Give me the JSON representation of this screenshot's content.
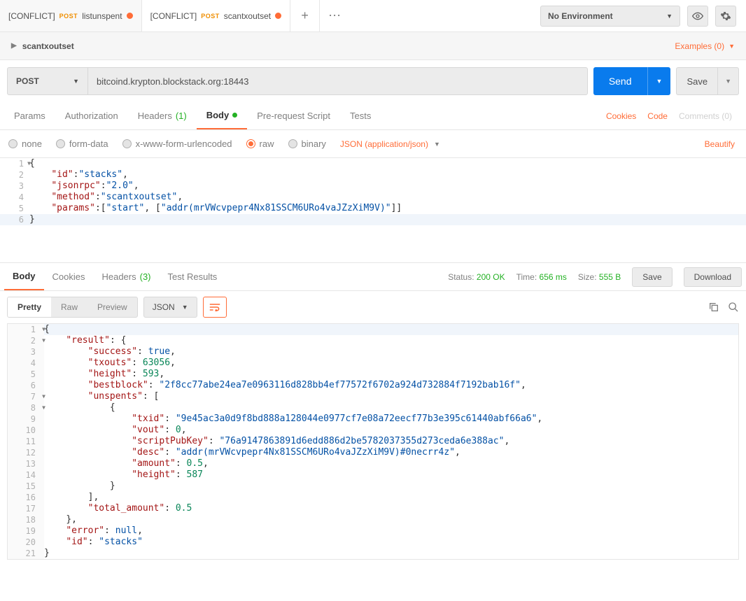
{
  "env": {
    "label": "No Environment"
  },
  "tabs": [
    {
      "conflict": "[CONFLICT]",
      "method": "POST",
      "name": "listunspent"
    },
    {
      "conflict": "[CONFLICT]",
      "method": "POST",
      "name": "scantxoutset"
    }
  ],
  "request_name": "scantxoutset",
  "examples": "Examples (0)",
  "method": "POST",
  "url": "bitcoind.krypton.blockstack.org:18443",
  "send": "Send",
  "save": "Save",
  "req_tabs": {
    "params": "Params",
    "auth": "Authorization",
    "headers": "Headers",
    "headers_count": "(1)",
    "body": "Body",
    "prereq": "Pre-request Script",
    "tests": "Tests"
  },
  "req_right": {
    "cookies": "Cookies",
    "code": "Code",
    "comments": "Comments (0)"
  },
  "body_types": {
    "none": "none",
    "formdata": "form-data",
    "xwww": "x-www-form-urlencoded",
    "raw": "raw",
    "binary": "binary",
    "content_type": "JSON (application/json)",
    "beautify": "Beautify"
  },
  "request_body": [
    {
      "n": "1",
      "fold": true,
      "hl": false,
      "indent": 0,
      "tokens": [
        [
          "brace",
          "{"
        ]
      ]
    },
    {
      "n": "2",
      "fold": false,
      "hl": false,
      "indent": 1,
      "tokens": [
        [
          "key",
          "\"id\""
        ],
        [
          "punct",
          ":"
        ],
        [
          "str",
          "\"stacks\""
        ],
        [
          "punct",
          ","
        ]
      ]
    },
    {
      "n": "3",
      "fold": false,
      "hl": false,
      "indent": 1,
      "tokens": [
        [
          "key",
          "\"jsonrpc\""
        ],
        [
          "punct",
          ":"
        ],
        [
          "str",
          "\"2.0\""
        ],
        [
          "punct",
          ","
        ]
      ]
    },
    {
      "n": "4",
      "fold": false,
      "hl": false,
      "indent": 1,
      "tokens": [
        [
          "key",
          "\"method\""
        ],
        [
          "punct",
          ":"
        ],
        [
          "str",
          "\"scantxoutset\""
        ],
        [
          "punct",
          ","
        ]
      ]
    },
    {
      "n": "5",
      "fold": false,
      "hl": false,
      "indent": 1,
      "tokens": [
        [
          "key",
          "\"params\""
        ],
        [
          "punct",
          ":["
        ],
        [
          "str",
          "\"start\""
        ],
        [
          "punct",
          ", ["
        ],
        [
          "str",
          "\"addr(mrVWcvpepr4Nx81SSCM6URo4vaJZzXiM9V)\""
        ],
        [
          "punct",
          "]]"
        ]
      ]
    },
    {
      "n": "6",
      "fold": false,
      "hl": true,
      "indent": 0,
      "tokens": [
        [
          "brace",
          "}"
        ]
      ]
    }
  ],
  "resp_tabs": {
    "body": "Body",
    "cookies": "Cookies",
    "headers": "Headers",
    "headers_count": "(3)",
    "tests": "Test Results"
  },
  "resp_meta": {
    "status_label": "Status:",
    "status_value": "200 OK",
    "time_label": "Time:",
    "time_value": "656 ms",
    "size_label": "Size:",
    "size_value": "555 B",
    "save": "Save",
    "download": "Download"
  },
  "view_tabs": {
    "pretty": "Pretty",
    "raw": "Raw",
    "preview": "Preview",
    "format": "JSON"
  },
  "response_body": [
    {
      "n": "1",
      "fold": true,
      "hl": true,
      "indent": 0,
      "tokens": [
        [
          "brace",
          "{"
        ]
      ]
    },
    {
      "n": "2",
      "fold": true,
      "hl": false,
      "indent": 1,
      "tokens": [
        [
          "key",
          "\"result\""
        ],
        [
          "punct",
          ": "
        ],
        [
          "brace",
          "{"
        ]
      ]
    },
    {
      "n": "3",
      "fold": false,
      "hl": false,
      "indent": 2,
      "tokens": [
        [
          "key",
          "\"success\""
        ],
        [
          "punct",
          ": "
        ],
        [
          "bool",
          "true"
        ],
        [
          "punct",
          ","
        ]
      ]
    },
    {
      "n": "4",
      "fold": false,
      "hl": false,
      "indent": 2,
      "tokens": [
        [
          "key",
          "\"txouts\""
        ],
        [
          "punct",
          ": "
        ],
        [
          "num",
          "63056"
        ],
        [
          "punct",
          ","
        ]
      ]
    },
    {
      "n": "5",
      "fold": false,
      "hl": false,
      "indent": 2,
      "tokens": [
        [
          "key",
          "\"height\""
        ],
        [
          "punct",
          ": "
        ],
        [
          "num",
          "593"
        ],
        [
          "punct",
          ","
        ]
      ]
    },
    {
      "n": "6",
      "fold": false,
      "hl": false,
      "indent": 2,
      "tokens": [
        [
          "key",
          "\"bestblock\""
        ],
        [
          "punct",
          ": "
        ],
        [
          "str",
          "\"2f8cc77abe24ea7e0963116d828bb4ef77572f6702a924d732884f7192bab16f\""
        ],
        [
          "punct",
          ","
        ]
      ]
    },
    {
      "n": "7",
      "fold": true,
      "hl": false,
      "indent": 2,
      "tokens": [
        [
          "key",
          "\"unspents\""
        ],
        [
          "punct",
          ": ["
        ]
      ]
    },
    {
      "n": "8",
      "fold": true,
      "hl": false,
      "indent": 3,
      "tokens": [
        [
          "brace",
          "{"
        ]
      ]
    },
    {
      "n": "9",
      "fold": false,
      "hl": false,
      "indent": 4,
      "tokens": [
        [
          "key",
          "\"txid\""
        ],
        [
          "punct",
          ": "
        ],
        [
          "str",
          "\"9e45ac3a0d9f8bd888a128044e0977cf7e08a72eecf77b3e395c61440abf66a6\""
        ],
        [
          "punct",
          ","
        ]
      ]
    },
    {
      "n": "10",
      "fold": false,
      "hl": false,
      "indent": 4,
      "tokens": [
        [
          "key",
          "\"vout\""
        ],
        [
          "punct",
          ": "
        ],
        [
          "num",
          "0"
        ],
        [
          "punct",
          ","
        ]
      ]
    },
    {
      "n": "11",
      "fold": false,
      "hl": false,
      "indent": 4,
      "tokens": [
        [
          "key",
          "\"scriptPubKey\""
        ],
        [
          "punct",
          ": "
        ],
        [
          "str",
          "\"76a9147863891d6edd886d2be5782037355d273ceda6e388ac\""
        ],
        [
          "punct",
          ","
        ]
      ]
    },
    {
      "n": "12",
      "fold": false,
      "hl": false,
      "indent": 4,
      "tokens": [
        [
          "key",
          "\"desc\""
        ],
        [
          "punct",
          ": "
        ],
        [
          "str",
          "\"addr(mrVWcvpepr4Nx81SSCM6URo4vaJZzXiM9V)#0necrr4z\""
        ],
        [
          "punct",
          ","
        ]
      ]
    },
    {
      "n": "13",
      "fold": false,
      "hl": false,
      "indent": 4,
      "tokens": [
        [
          "key",
          "\"amount\""
        ],
        [
          "punct",
          ": "
        ],
        [
          "num",
          "0.5"
        ],
        [
          "punct",
          ","
        ]
      ]
    },
    {
      "n": "14",
      "fold": false,
      "hl": false,
      "indent": 4,
      "tokens": [
        [
          "key",
          "\"height\""
        ],
        [
          "punct",
          ": "
        ],
        [
          "num",
          "587"
        ]
      ]
    },
    {
      "n": "15",
      "fold": false,
      "hl": false,
      "indent": 3,
      "tokens": [
        [
          "brace",
          "}"
        ]
      ]
    },
    {
      "n": "16",
      "fold": false,
      "hl": false,
      "indent": 2,
      "tokens": [
        [
          "punct",
          "],"
        ]
      ]
    },
    {
      "n": "17",
      "fold": false,
      "hl": false,
      "indent": 2,
      "tokens": [
        [
          "key",
          "\"total_amount\""
        ],
        [
          "punct",
          ": "
        ],
        [
          "num",
          "0.5"
        ]
      ]
    },
    {
      "n": "18",
      "fold": false,
      "hl": false,
      "indent": 1,
      "tokens": [
        [
          "brace",
          "}"
        ],
        [
          "punct",
          ","
        ]
      ]
    },
    {
      "n": "19",
      "fold": false,
      "hl": false,
      "indent": 1,
      "tokens": [
        [
          "key",
          "\"error\""
        ],
        [
          "punct",
          ": "
        ],
        [
          "null",
          "null"
        ],
        [
          "punct",
          ","
        ]
      ]
    },
    {
      "n": "20",
      "fold": false,
      "hl": false,
      "indent": 1,
      "tokens": [
        [
          "key",
          "\"id\""
        ],
        [
          "punct",
          ": "
        ],
        [
          "str",
          "\"stacks\""
        ]
      ]
    },
    {
      "n": "21",
      "fold": false,
      "hl": false,
      "indent": 0,
      "tokens": [
        [
          "brace",
          "}"
        ]
      ]
    }
  ]
}
